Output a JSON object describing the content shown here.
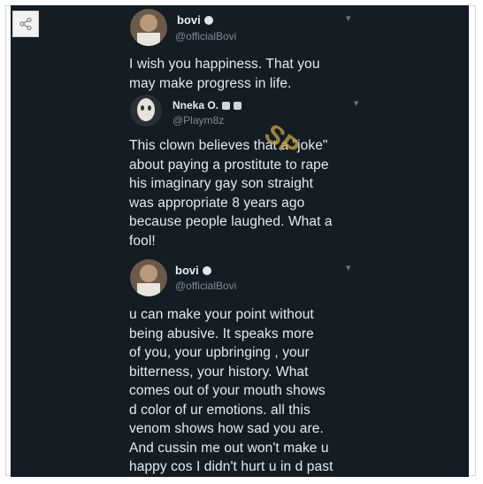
{
  "tweets": [
    {
      "name": "bovi",
      "handle": "@officialBovi",
      "text_lines": [
        "I wish you happiness. That you",
        "may make progress in life."
      ]
    },
    {
      "name": "Nneka O.",
      "handle": "@Playm8z",
      "text_lines": [
        "This clown believes that a \"joke\"",
        "about paying a prostitute to rape",
        "his imaginary gay son straight",
        "was appropriate 8 years ago",
        "because people laughed. What a",
        "fool!"
      ]
    },
    {
      "name": "bovi",
      "handle": "@officialBovi",
      "text_lines": [
        "u can make your point without",
        "being abusive. It speaks more",
        "of you, your upbringing , your",
        "bitterness, your history. What",
        "comes out of your mouth shows",
        "d color of ur emotions. all this",
        "venom shows how sad you are.",
        "And cussin me out won't make u",
        "happy cos I didn't hurt u in d past"
      ]
    }
  ],
  "watermark": "SP",
  "icons": {
    "share": "share-icon",
    "chevron": "chevron-down-icon",
    "verified": "verified-badge-icon",
    "lock": "lock-icon"
  },
  "colors": {
    "background": "#141c24",
    "text": "#e6ebef",
    "muted": "#7e8a96",
    "watermark": "#c9a640"
  }
}
